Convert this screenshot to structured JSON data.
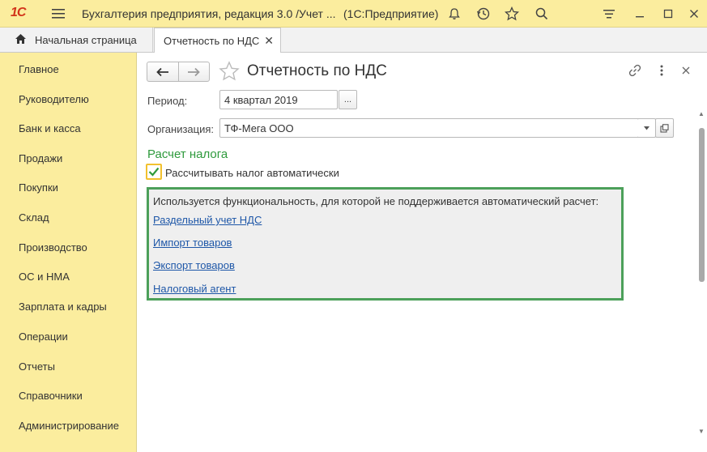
{
  "titlebar": {
    "logo": "1С",
    "title": "Бухгалтерия предприятия, редакция 3.0 /Учет ...",
    "platform": "(1С:Предприятие)",
    "icons": [
      "menu-icon",
      "bell-icon",
      "history-icon",
      "star-icon",
      "search-icon",
      "settings-icon",
      "minimize-icon",
      "maximize-icon",
      "close-icon"
    ]
  },
  "tabs": {
    "home_label": "Начальная страница",
    "active_label": "Отчетность по НДС"
  },
  "sidebar": {
    "items": [
      {
        "label": "Главное"
      },
      {
        "label": "Руководителю"
      },
      {
        "label": "Банк и касса"
      },
      {
        "label": "Продажи"
      },
      {
        "label": "Покупки"
      },
      {
        "label": "Склад"
      },
      {
        "label": "Производство"
      },
      {
        "label": "ОС и НМА"
      },
      {
        "label": "Зарплата и кадры"
      },
      {
        "label": "Операции"
      },
      {
        "label": "Отчеты"
      },
      {
        "label": "Справочники"
      },
      {
        "label": "Администрирование"
      }
    ]
  },
  "form": {
    "title": "Отчетность по НДС",
    "period_label": "Период:",
    "period_value": "4 квартал 2019",
    "period_button": "...",
    "org_label": "Организация:",
    "org_value": "ТФ-Мега ООО",
    "section_title": "Расчет налога",
    "auto_calc_label": "Рассчитывать налог автоматически",
    "auto_calc_checked": true,
    "info_text": "Используется функциональность, для которой не поддерживается автоматический расчет:",
    "links": [
      {
        "label": "Раздельный учет НДС"
      },
      {
        "label": "Импорт товаров"
      },
      {
        "label": "Экспорт товаров"
      },
      {
        "label": "Налоговый агент"
      }
    ]
  },
  "colors": {
    "accent_yellow": "#fbed9e",
    "section_green": "#2e9a3c",
    "link_blue": "#1e57a8",
    "logo_red": "#d2341a"
  }
}
